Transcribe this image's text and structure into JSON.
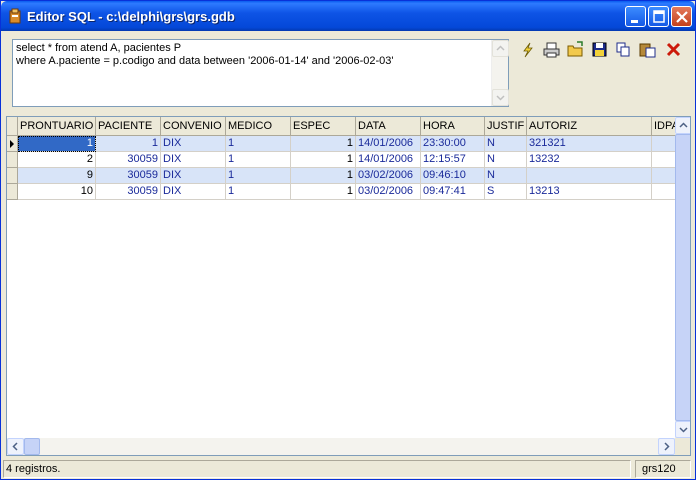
{
  "window": {
    "title": "Editor SQL - c:\\delphi\\grs\\grs.gdb"
  },
  "sql": {
    "text": "select * from atend A, pacientes P\nwhere A.paciente = p.codigo and data between '2006-01-14' and '2006-02-03'"
  },
  "toolbar": {
    "icons": [
      "execute-icon",
      "print-icon",
      "open-folder-icon",
      "save-icon",
      "copy-icon",
      "paste-icon",
      "close-icon"
    ]
  },
  "grid": {
    "columns": [
      "PRONTUARIO",
      "PACIENTE",
      "CONVENIO",
      "MEDICO",
      "ESPEC",
      "DATA",
      "HORA",
      "JUSTIF",
      "AUTORIZ",
      "IDPA"
    ],
    "rows": [
      [
        "1",
        "1",
        "DIX",
        "1",
        "1",
        "14/01/2006",
        "23:30:00",
        "N",
        "321321",
        ""
      ],
      [
        "2",
        "30059",
        "DIX",
        "1",
        "1",
        "14/01/2006",
        "12:15:57",
        "N",
        "13232",
        ""
      ],
      [
        "9",
        "30059",
        "DIX",
        "1",
        "1",
        "03/02/2006",
        "09:46:10",
        "N",
        "",
        ""
      ],
      [
        "10",
        "30059",
        "DIX",
        "1",
        "1",
        "03/02/2006",
        "09:47:41",
        "S",
        "13213",
        ""
      ]
    ]
  },
  "status": {
    "records": "4 registros.",
    "user": "grs120"
  },
  "colors": {
    "title_bar": "#0448d8",
    "row_alt": "#d8e4f8",
    "selection": "#3169c6",
    "cell_text_blue": "#1a2a9a",
    "close_red": "#c3401c"
  }
}
